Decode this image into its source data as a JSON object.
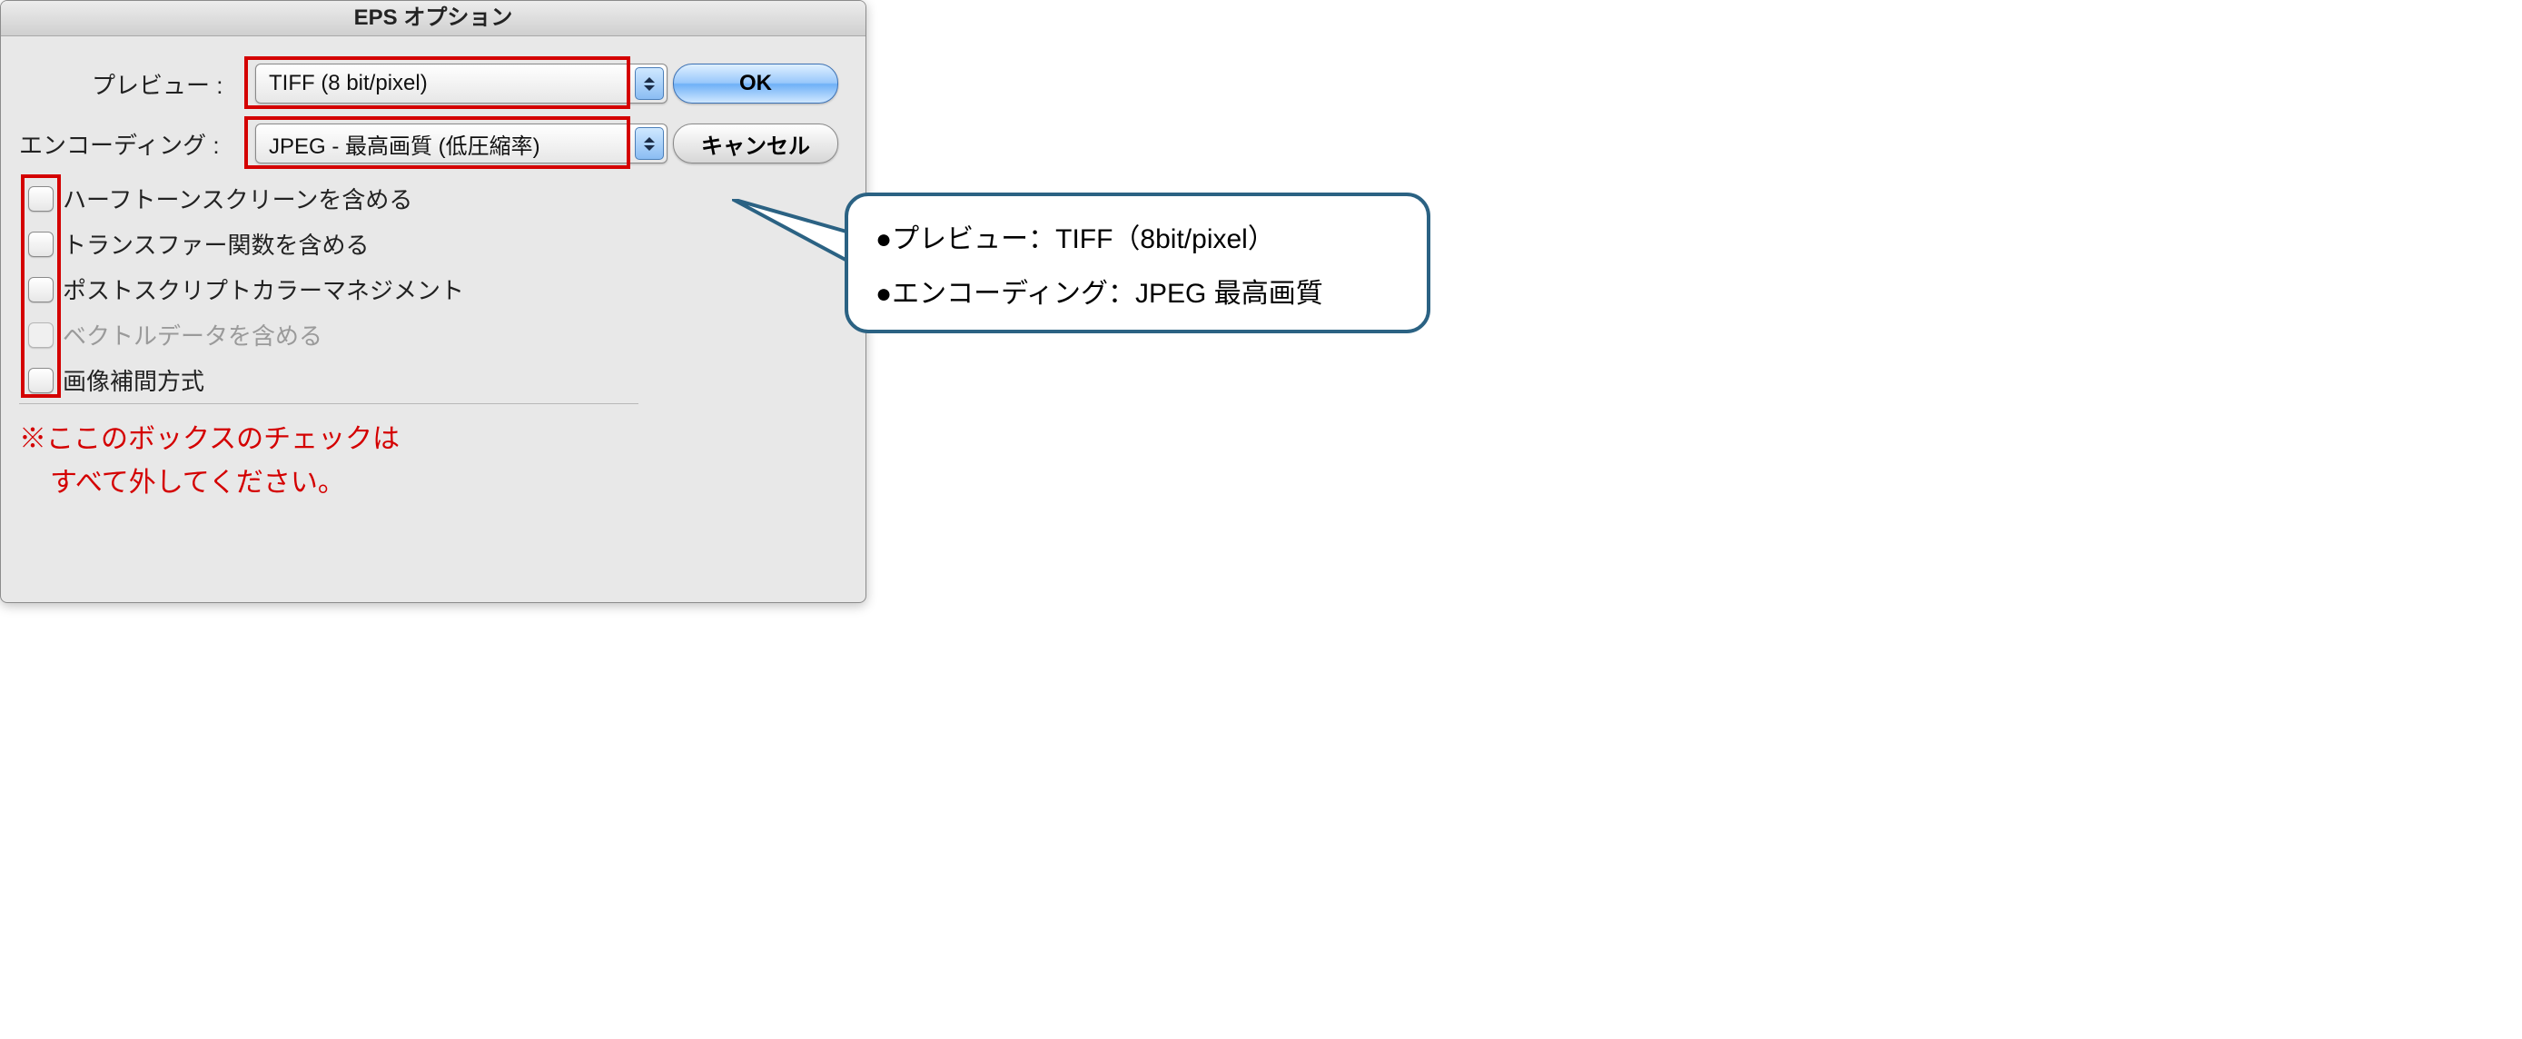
{
  "dialog": {
    "title": "EPS オプション",
    "fields": {
      "preview": {
        "label": "プレビュー :",
        "value": "TIFF (8 bit/pixel)"
      },
      "encoding": {
        "label": "エンコーディング :",
        "value": "JPEG - 最高画質 (低圧縮率)"
      }
    },
    "checkboxes": {
      "halftone": {
        "label": "ハーフトーンスクリーンを含める",
        "checked": false,
        "enabled": true
      },
      "transfer": {
        "label": "トランスファー関数を含める",
        "checked": false,
        "enabled": true
      },
      "pscolormgmt": {
        "label": "ポストスクリプトカラーマネジメント",
        "checked": false,
        "enabled": true
      },
      "vector": {
        "label": "ベクトルデータを含める",
        "checked": false,
        "enabled": false
      },
      "interp": {
        "label": "画像補間方式",
        "checked": false,
        "enabled": true
      }
    },
    "buttons": {
      "ok": "OK",
      "cancel": "キャンセル"
    }
  },
  "note": {
    "line1": "※ここのボックスのチェックは",
    "line2": "すべて外してください。"
  },
  "callout": {
    "line1": "●プレビュー：TIFF（8bit/pixel）",
    "line2": "●エンコーディング：JPEG 最高画質"
  }
}
